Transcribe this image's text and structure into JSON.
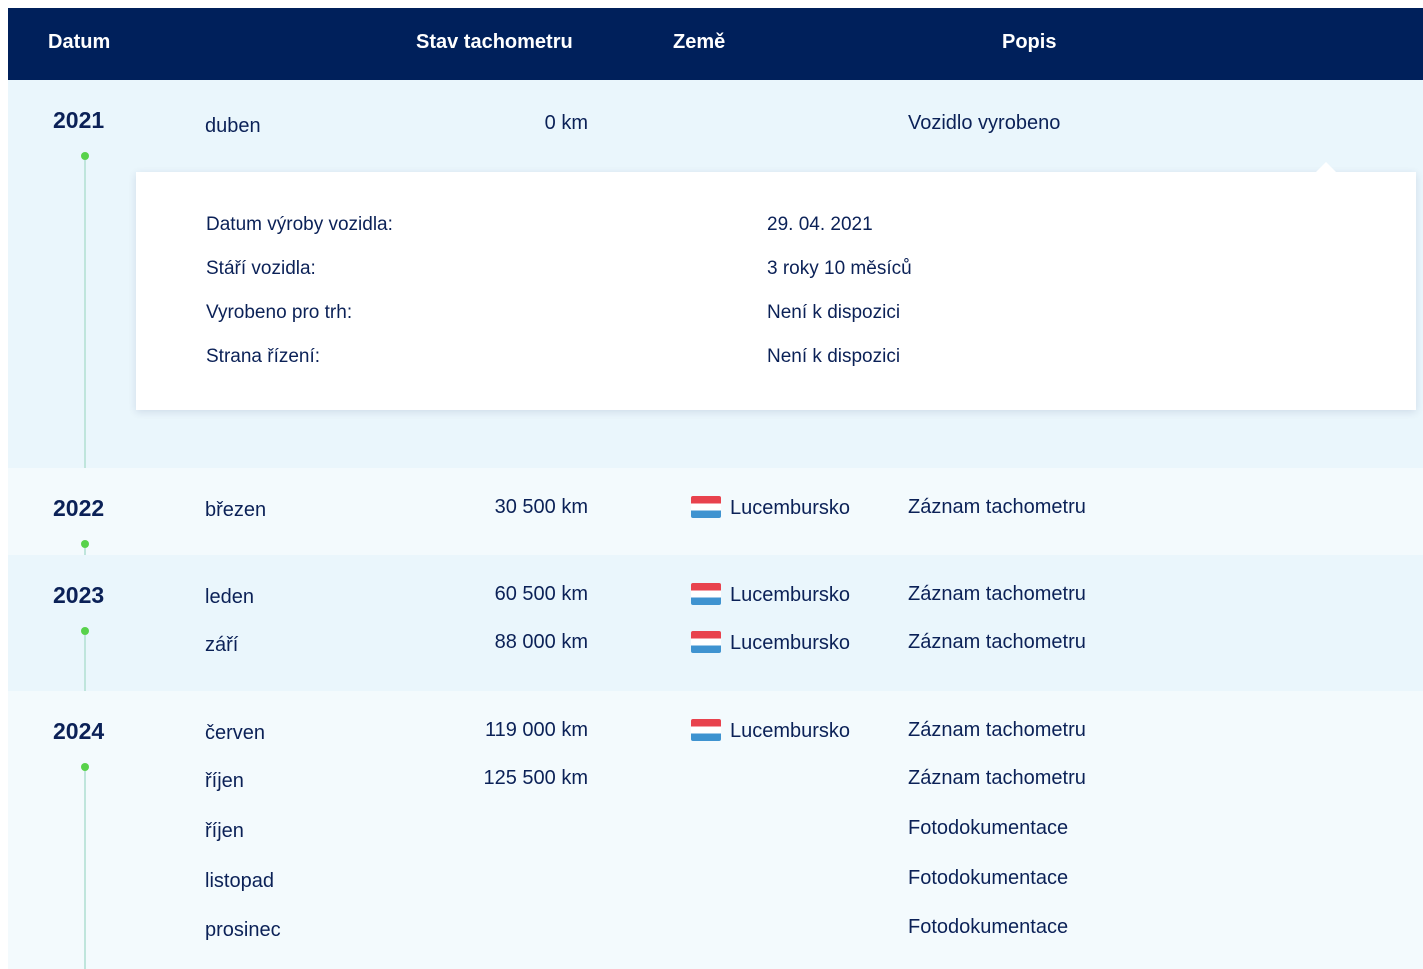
{
  "header": {
    "datum": "Datum",
    "stav": "Stav tachometru",
    "zeme": "Země",
    "popis": "Popis"
  },
  "colors": {
    "header_bg": "#00205b",
    "accent_dot": "#58d24b",
    "text": "#0b2157"
  },
  "groups": [
    {
      "year": "2021",
      "rows": [
        {
          "month": "duben",
          "km": "0 km",
          "country": "",
          "description": "Vozidlo vyrobeno"
        }
      ],
      "details": [
        {
          "label": "Datum výroby vozidla:",
          "value": "29. 04. 2021"
        },
        {
          "label": "Stáří vozidla:",
          "value": "3 roky 10 měsíců"
        },
        {
          "label": "Vyrobeno pro trh:",
          "value": "Není k dispozici"
        },
        {
          "label": "Strana řízení:",
          "value": "Není k dispozici"
        }
      ]
    },
    {
      "year": "2022",
      "rows": [
        {
          "month": "březen",
          "km": "30 500 km",
          "country": "Lucembursko",
          "description": "Záznam tachometru"
        }
      ]
    },
    {
      "year": "2023",
      "rows": [
        {
          "month": "leden",
          "km": "60 500 km",
          "country": "Lucembursko",
          "description": "Záznam tachometru"
        },
        {
          "month": "září",
          "km": "88 000 km",
          "country": "Lucembursko",
          "description": "Záznam tachometru"
        }
      ]
    },
    {
      "year": "2024",
      "rows": [
        {
          "month": "červen",
          "km": "119 000 km",
          "country": "Lucembursko",
          "description": "Záznam tachometru"
        },
        {
          "month": "říjen",
          "km": "125 500 km",
          "country": "",
          "description": "Záznam tachometru"
        },
        {
          "month": "říjen",
          "km": "",
          "country": "",
          "description": "Fotodokumentace"
        },
        {
          "month": "listopad",
          "km": "",
          "country": "",
          "description": "Fotodokumentace"
        },
        {
          "month": "prosinec",
          "km": "",
          "country": "",
          "description": "Fotodokumentace"
        }
      ]
    }
  ]
}
